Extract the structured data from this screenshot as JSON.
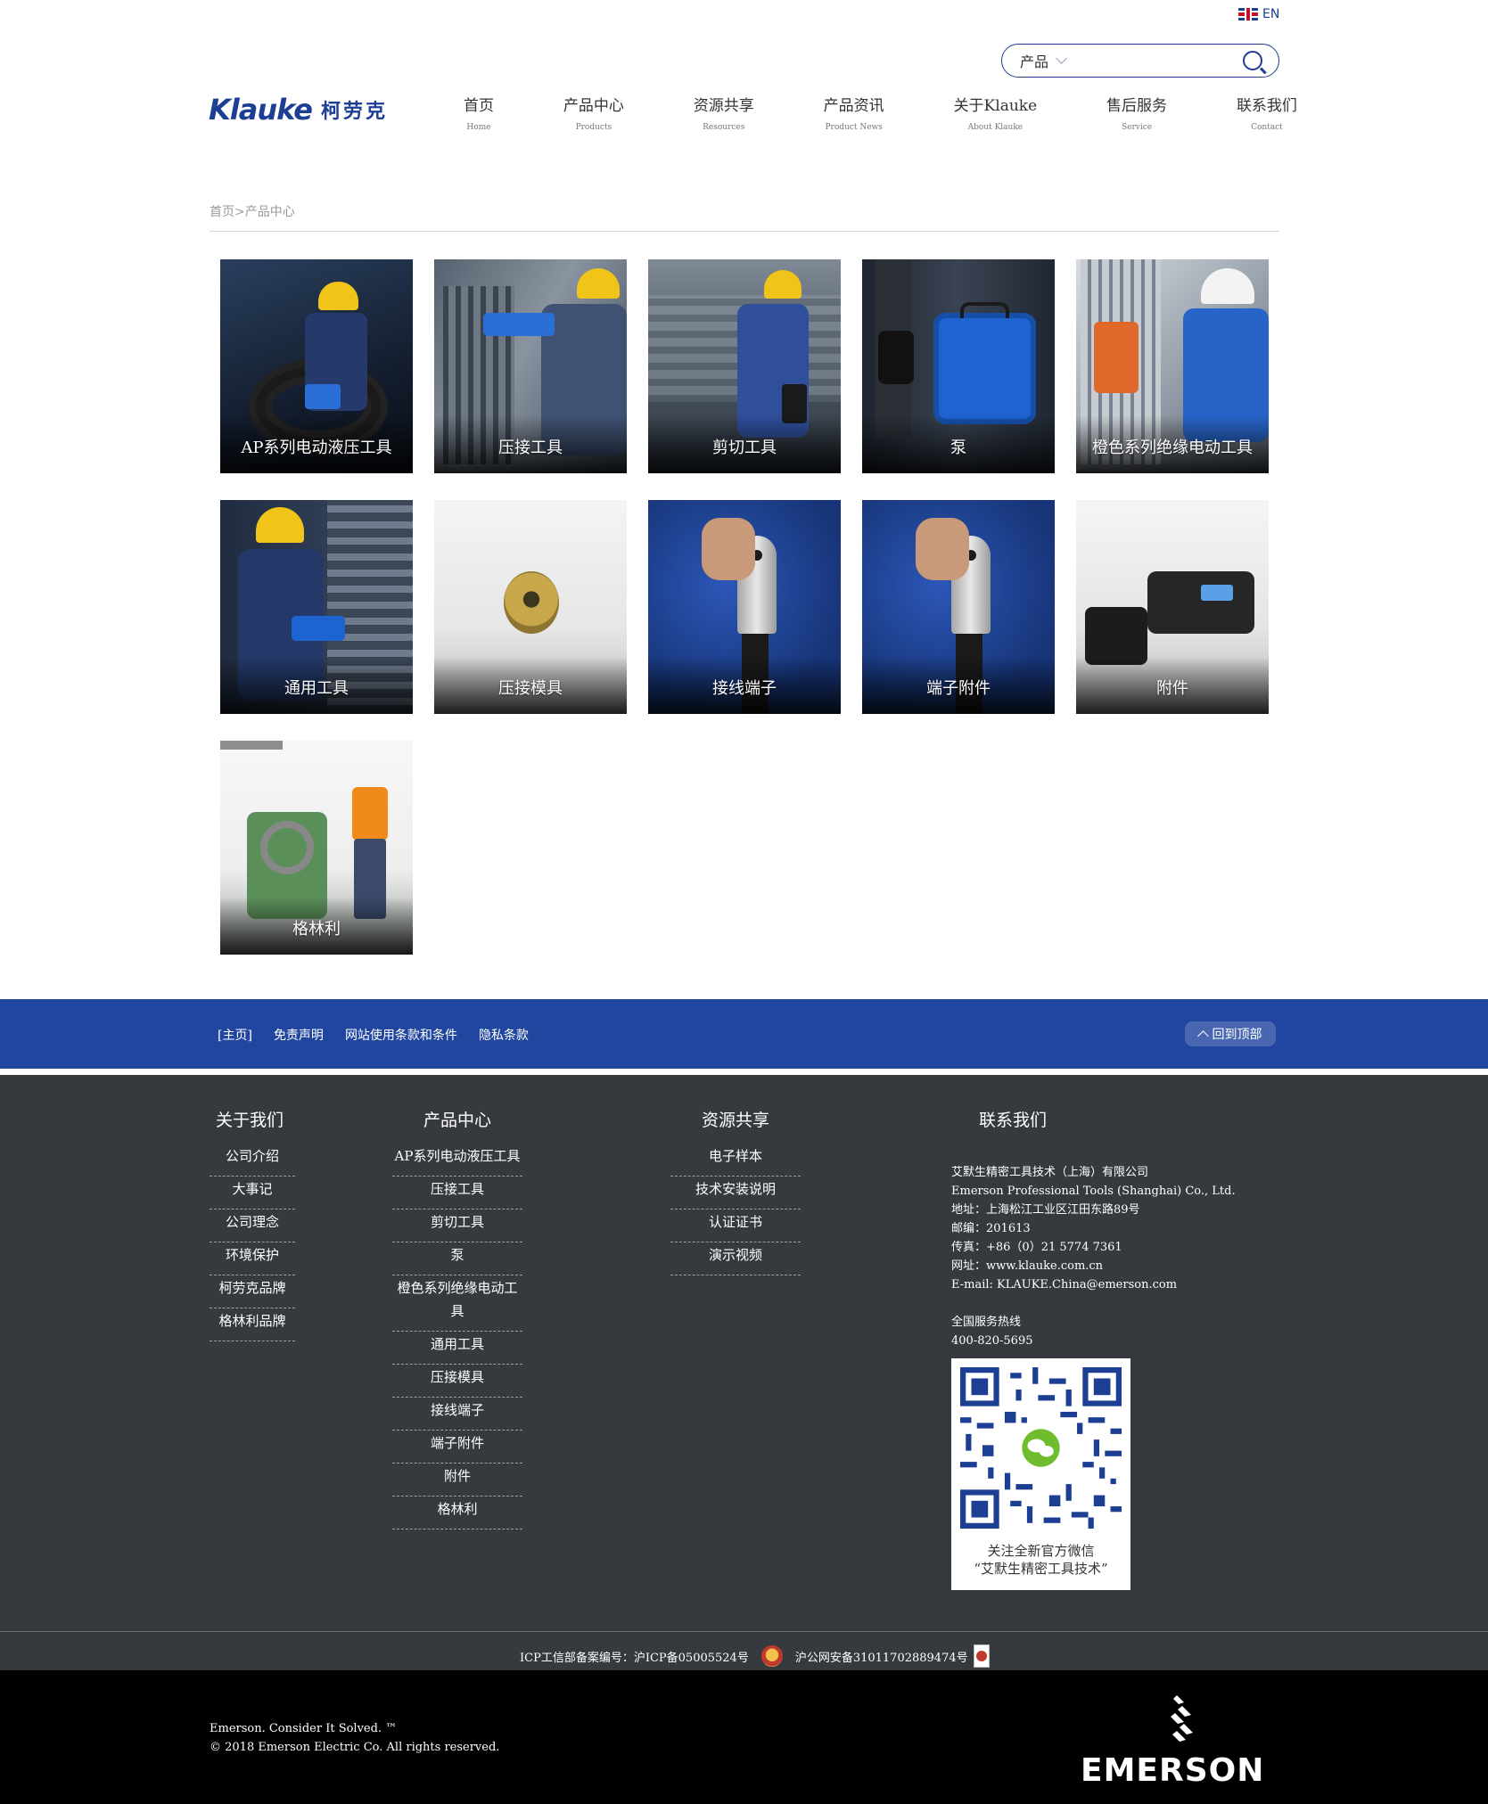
{
  "header": {
    "lang": "EN",
    "search": {
      "category": "产品",
      "placeholder": ""
    },
    "logo": {
      "en": "Klauke",
      "cn": "柯劳克"
    },
    "nav": [
      {
        "cn": "首页",
        "en": "Home"
      },
      {
        "cn": "产品中心",
        "en": "Products"
      },
      {
        "cn": "资源共享",
        "en": "Resources"
      },
      {
        "cn": "产品资讯",
        "en": "Product News"
      },
      {
        "cn": "关于Klauke",
        "en": "About Klauke"
      },
      {
        "cn": "售后服务",
        "en": "Service"
      },
      {
        "cn": "联系我们",
        "en": "Contact"
      }
    ]
  },
  "breadcrumb": "首页>产品中心",
  "products": [
    "AP系列电动液压工具",
    "压接工具",
    "剪切工具",
    "泵",
    "橙色系列绝缘电动工具",
    "通用工具",
    "压接模具",
    "接线端子",
    "端子附件",
    "附件",
    "格林利"
  ],
  "bluebar": {
    "links": [
      "[主页]",
      "免责声明",
      "网站使用条款和条件",
      "隐私条款"
    ],
    "back_to_top": "回到顶部"
  },
  "footer": {
    "about": {
      "title": "关于我们",
      "items": [
        "公司介绍",
        "大事记",
        "公司理念",
        "环境保护",
        "柯劳克品牌",
        "格林利品牌"
      ]
    },
    "products": {
      "title": "产品中心",
      "items": [
        "AP系列电动液压工具",
        "压接工具",
        "剪切工具",
        "泵",
        "橙色系列绝缘电动工具",
        "通用工具",
        "压接模具",
        "接线端子",
        "端子附件",
        "附件",
        "格林利"
      ]
    },
    "resources": {
      "title": "资源共享",
      "items": [
        "电子样本",
        "技术安装说明",
        "认证证书",
        "演示视频"
      ]
    },
    "contact": {
      "title": "联系我们",
      "company_cn": "艾默生精密工具技术（上海）有限公司",
      "company_en": "Emerson Professional Tools (Shanghai) Co., Ltd.",
      "address": "地址：上海松江工业区江田东路89号",
      "postcode": "邮编：201613",
      "fax": "传真：+86（0）21 5774 7361",
      "website": "网址：www.klauke.com.cn",
      "email": "E-mail: KLAUKE.China@emerson.com",
      "hotline_label": "全国服务热线",
      "hotline": "400-820-5695",
      "qr_caption_1": "关注全新官方微信",
      "qr_caption_2": "“艾默生精密工具技术”"
    }
  },
  "icp": {
    "text": "ICP工信部备案编号：沪ICP备05005524号",
    "police": "沪公网安备31011702889474号"
  },
  "bottom": {
    "slogan": "Emerson. Consider It Solved. ™",
    "copyright": "© 2018 Emerson Electric Co. All rights reserved.",
    "brand": "EMERSON"
  },
  "colors": {
    "brand_blue": "#1c3f94",
    "bar_blue": "#2146a0",
    "footer_dark": "#363a3e"
  }
}
